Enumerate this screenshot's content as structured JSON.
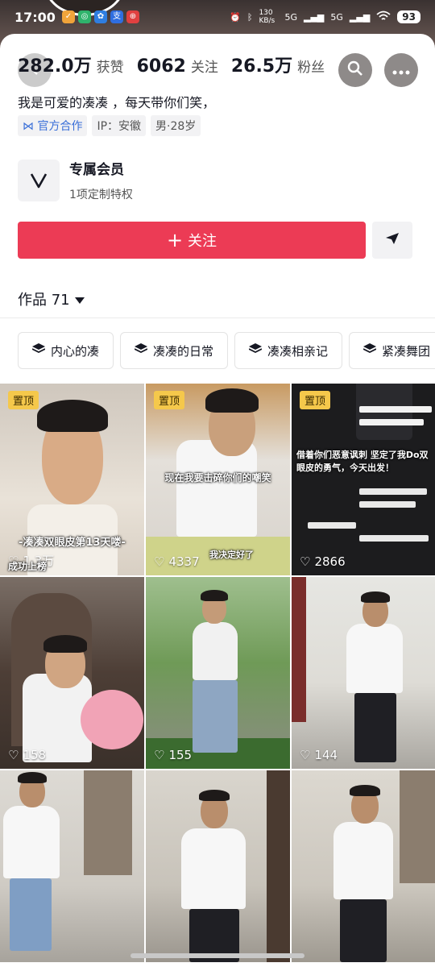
{
  "status_bar": {
    "time": "17:00",
    "network_speed": "130 KB/s",
    "signal1": "5G",
    "signal2": "5G",
    "battery": "93"
  },
  "profile": {
    "stats": [
      {
        "value": "282.0万",
        "label": "获赞"
      },
      {
        "value": "6062",
        "label": "关注"
      },
      {
        "value": "26.5万",
        "label": "粉丝"
      }
    ],
    "bio": "我是可爱的凑凑 ，每天带你们笑，",
    "tags": [
      "官方合作",
      "IP：安徽",
      "男·28岁"
    ]
  },
  "member": {
    "title": "专属会员",
    "subtitle": "1项定制特权"
  },
  "actions": {
    "follow_label": "关注"
  },
  "works": {
    "label": "作品 71"
  },
  "collections": [
    "内心的凑",
    "凑凑的日常",
    "凑凑相亲记",
    "紧凑舞团"
  ],
  "videos": [
    {
      "pinned": true,
      "pin_label": "置顶",
      "likes": "1.3万",
      "caption": "-凑凑双眼皮第13天喽-",
      "bottom_caption": "成功上榜"
    },
    {
      "pinned": true,
      "pin_label": "置顶",
      "likes": "4337",
      "caption": "现在我要击碎你们的嘲笑",
      "bottom_caption": "我决定好了"
    },
    {
      "pinned": true,
      "pin_label": "置顶",
      "likes": "2866",
      "caption": "借着你们恶意讽刺 坚定了我Do双眼皮的勇气，今天出发！",
      "bottom_caption": ""
    },
    {
      "pinned": false,
      "likes": "158",
      "caption": "",
      "bottom_caption": ""
    },
    {
      "pinned": false,
      "likes": "155",
      "caption": "",
      "bottom_caption": ""
    },
    {
      "pinned": false,
      "likes": "144",
      "caption": "",
      "bottom_caption": ""
    },
    {
      "pinned": false,
      "likes": "",
      "caption": "",
      "bottom_caption": ""
    },
    {
      "pinned": false,
      "likes": "",
      "caption": "",
      "bottom_caption": ""
    },
    {
      "pinned": false,
      "likes": "",
      "caption": "",
      "bottom_caption": ""
    }
  ],
  "colors": {
    "accent": "#ec3b55",
    "pin": "#f5c84b",
    "official_tag": "#3a6fd8"
  },
  "icons": [
    "back-icon",
    "search-icon",
    "more-icon",
    "official-badge-icon",
    "member-v-icon",
    "plus-icon",
    "share-arrow-icon",
    "dropdown-caret-icon",
    "collection-stack-icon",
    "heart-icon"
  ]
}
